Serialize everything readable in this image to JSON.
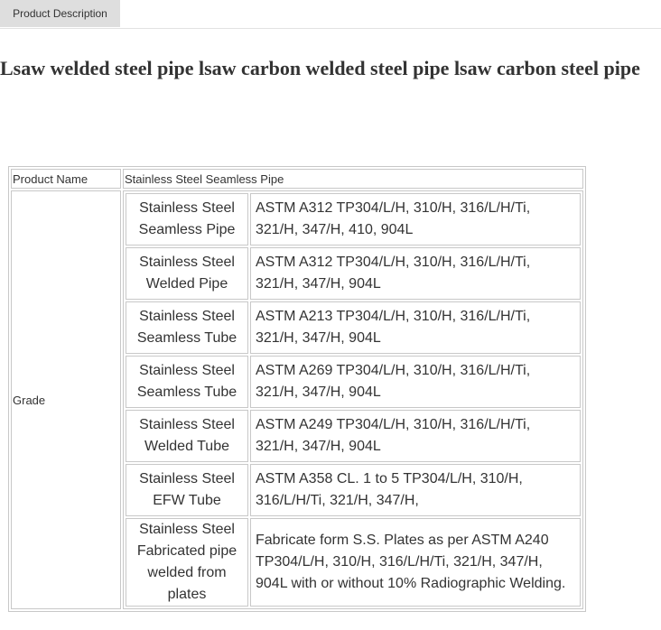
{
  "tabs": {
    "active_label": "Product Description"
  },
  "title": "Lsaw welded steel pipe lsaw carbon welded steel pipe lsaw carbon steel pipe",
  "table": {
    "product_name_label": "Product Name",
    "product_name_value": "Stainless Steel Seamless Pipe",
    "grade_label": "Grade",
    "grades": [
      {
        "type": "Stainless Steel Seamless Pipe",
        "spec": "ASTM A312 TP304/L/H, 310/H, 316/L/H/Ti, 321/H, 347/H, 410, 904L"
      },
      {
        "type": "Stainless Steel Welded Pipe",
        "spec": "ASTM A312 TP304/L/H, 310/H, 316/L/H/Ti, 321/H, 347/H, 904L"
      },
      {
        "type": "Stainless Steel Seamless Tube",
        "spec": "ASTM A213 TP304/L/H, 310/H, 316/L/H/Ti, 321/H, 347/H, 904L"
      },
      {
        "type": "Stainless Steel Seamless Tube",
        "spec": "ASTM A269 TP304/L/H, 310/H, 316/L/H/Ti, 321/H, 347/H, 904L"
      },
      {
        "type": "Stainless Steel Welded Tube",
        "spec": "ASTM A249 TP304/L/H, 310/H, 316/L/H/Ti, 321/H, 347/H, 904L"
      },
      {
        "type": "Stainless Steel EFW Tube",
        "spec": "ASTM A358 CL. 1 to 5 TP304/L/H, 310/H, 316/L/H/Ti, 321/H, 347/H,"
      },
      {
        "type": "Stainless Steel Fabricated pipe welded from plates",
        "spec": "Fabricate form S.S. Plates as per ASTM A240 TP304/L/H, 310/H, 316/L/H/Ti,   321/H, 347/H, 904L with or without 10% Radiographic Welding."
      }
    ]
  }
}
